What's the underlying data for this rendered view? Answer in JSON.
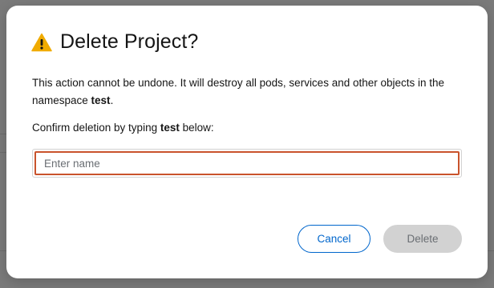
{
  "dialog": {
    "title": "Delete Project?",
    "message_prefix": "This action cannot be undone. It will destroy all pods, services and other objects in the namespace ",
    "namespace": "test",
    "message_suffix": ".",
    "confirm_prefix": "Confirm deletion by typing ",
    "confirm_name": "test",
    "confirm_suffix": " below:",
    "input": {
      "placeholder": "Enter name",
      "value": ""
    },
    "cancel_label": "Cancel",
    "delete_label": "Delete",
    "delete_disabled": true
  },
  "colors": {
    "warning": "#f0ab00",
    "primary_link": "#0066cc",
    "input_invalid_border": "#c9532c",
    "disabled_bg": "#d2d2d2",
    "disabled_text": "#6a6e73"
  },
  "icons": {
    "header": "warning-triangle-icon"
  }
}
